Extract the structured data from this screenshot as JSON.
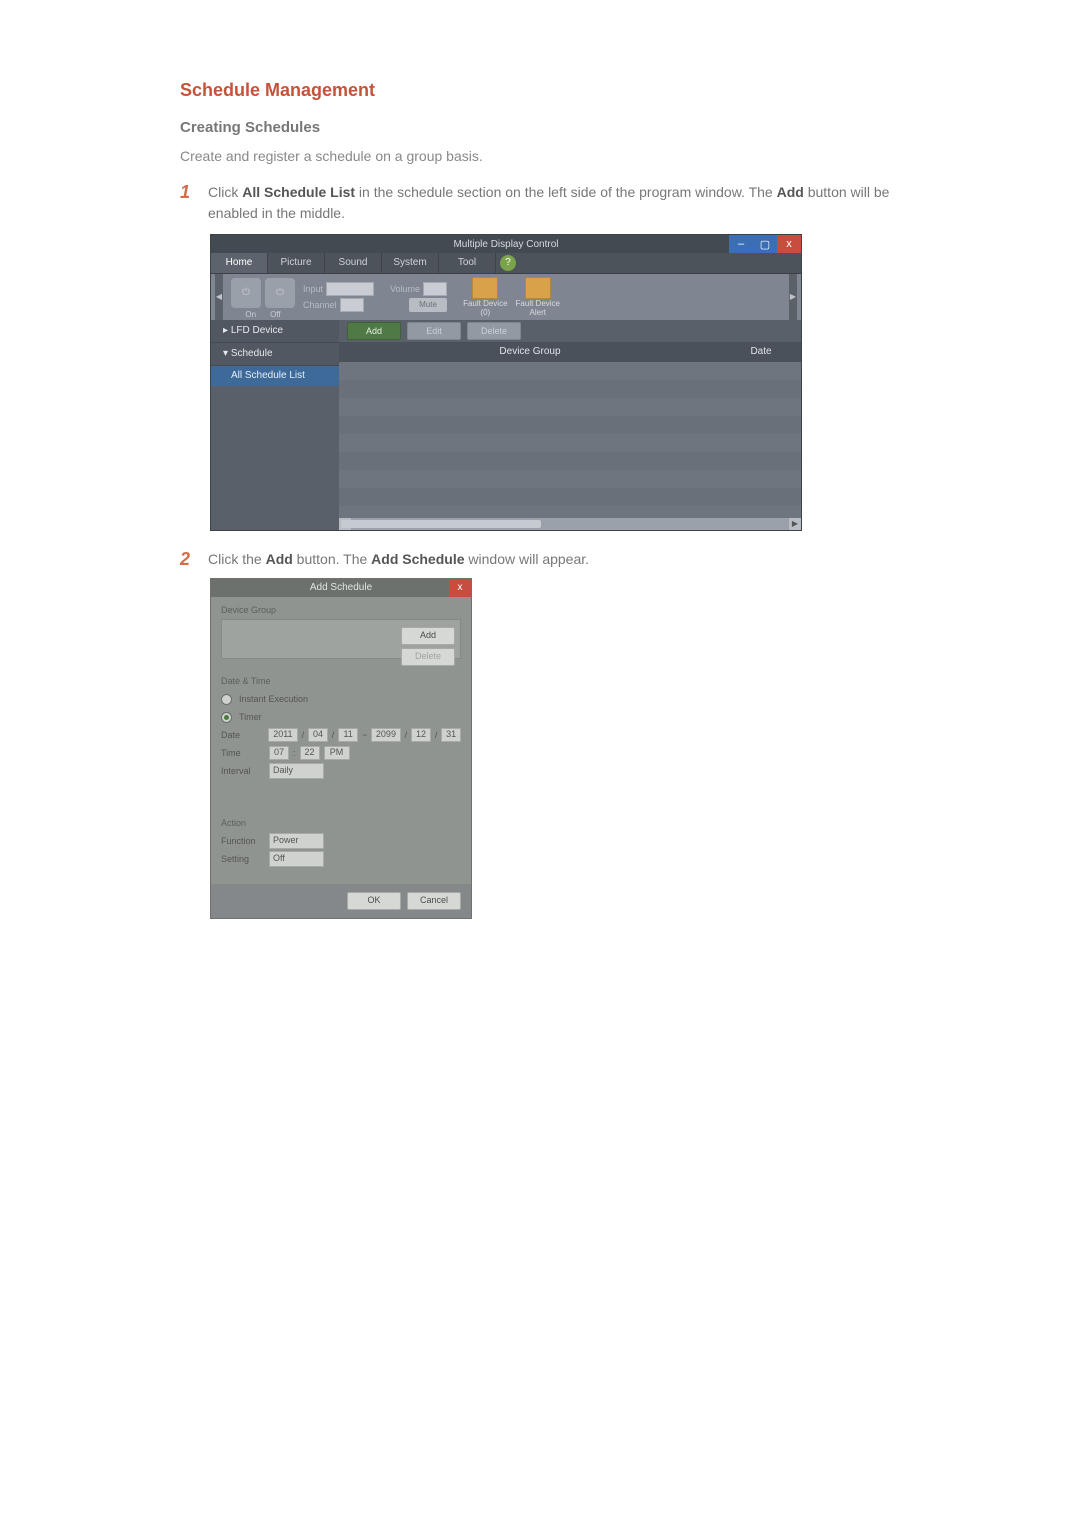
{
  "doc": {
    "section_title": "Schedule Management",
    "subsection_title": "Creating Schedules",
    "intro": "Create and register a schedule on a group basis.",
    "step1_num": "1",
    "step1_text_a": "Click ",
    "step1_bold_a": "All Schedule List",
    "step1_text_b": " in the schedule section on the left side of the program window. The ",
    "step1_bold_b": "Add",
    "step1_text_c": " button will be enabled in the middle.",
    "step2_num": "2",
    "step2_text_a": "Click the ",
    "step2_bold_a": "Add",
    "step2_text_b": " button. The ",
    "step2_bold_b": "Add Schedule",
    "step2_text_c": " window will appear."
  },
  "mdc": {
    "title": "Multiple Display Control",
    "tabs": {
      "home": "Home",
      "picture": "Picture",
      "sound": "Sound",
      "system": "System",
      "tool": "Tool"
    },
    "help": "?",
    "ribbon": {
      "on": "On",
      "off": "Off",
      "input": "Input",
      "channel": "Channel",
      "volume": "Volume",
      "mute": "Mute",
      "fault_device": "Fault Device\n(0)",
      "fault_alert": "Fault Device\nAlert"
    },
    "side": {
      "lfd": "LFD Device",
      "schedule": "Schedule",
      "all": "All Schedule List"
    },
    "toolbar": {
      "add": "Add",
      "edit": "Edit",
      "delete": "Delete"
    },
    "cols": {
      "group": "Device Group",
      "date": "Date"
    },
    "win": {
      "min": "–",
      "max": "▢",
      "close": "x"
    }
  },
  "dlg": {
    "title": "Add Schedule",
    "close": "x",
    "device_group": "Device Group",
    "add": "Add",
    "delete": "Delete",
    "date_time": "Date & Time",
    "instant": "Instant Execution",
    "timer": "Timer",
    "date_label": "Date",
    "date_from": {
      "y": "2011",
      "m": "04",
      "d": "11"
    },
    "date_sep": "~",
    "date_to": {
      "y": "2099",
      "m": "12",
      "d": "31"
    },
    "slash": "/",
    "time_label": "Time",
    "time": {
      "h": "07",
      "m": "22",
      "ampm": "PM"
    },
    "colon": ":",
    "interval_label": "Interval",
    "interval": "Daily",
    "action": "Action",
    "function_label": "Function",
    "function": "Power",
    "setting_label": "Setting",
    "setting": "Off",
    "ok": "OK",
    "cancel": "Cancel"
  }
}
